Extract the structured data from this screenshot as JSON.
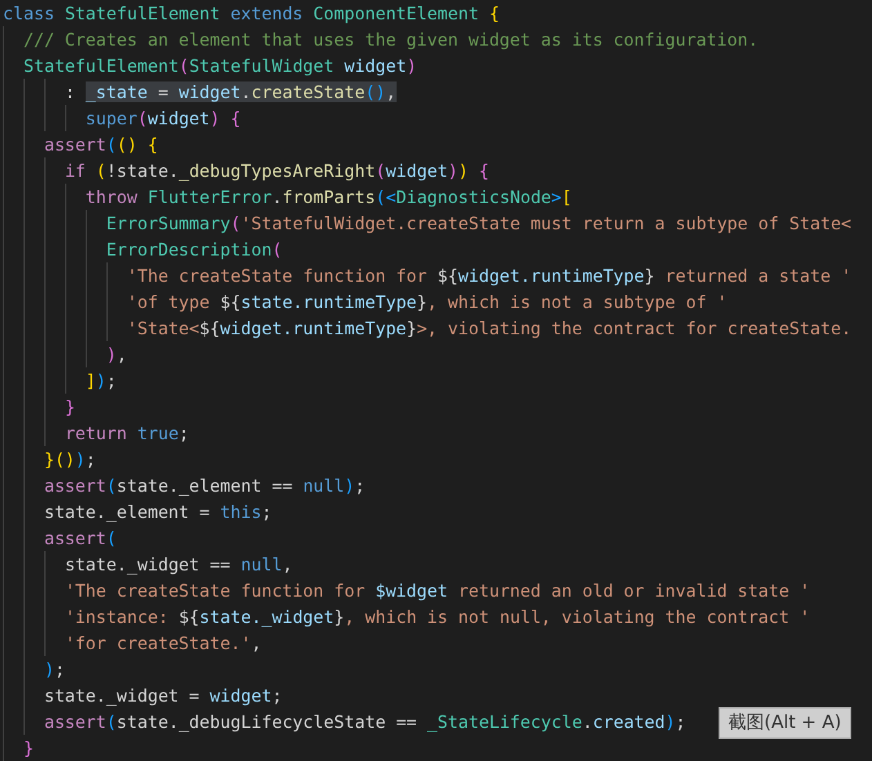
{
  "editor": {
    "lines": [
      {
        "tokens": [
          {
            "kind": "keyword",
            "text": "class "
          },
          {
            "kind": "type",
            "text": "StatefulElement "
          },
          {
            "kind": "keyword",
            "text": "extends "
          },
          {
            "kind": "type",
            "text": "ComponentElement "
          },
          {
            "kind": "b1",
            "text": "{"
          }
        ]
      },
      {
        "tokens": [
          {
            "kind": "comment",
            "text": "  /// Creates an element that uses the given widget as its configuration."
          }
        ]
      },
      {
        "tokens": [
          {
            "kind": "type",
            "text": "  StatefulElement"
          },
          {
            "kind": "b2",
            "text": "("
          },
          {
            "kind": "type",
            "text": "StatefulWidget "
          },
          {
            "kind": "param",
            "text": "widget"
          },
          {
            "kind": "b2",
            "text": ")"
          }
        ]
      },
      {
        "tokens": [
          {
            "kind": "plain",
            "text": "      : "
          },
          {
            "kind": "param",
            "text": "_state",
            "highlighted": true
          },
          {
            "kind": "plain",
            "text": " = ",
            "highlighted": true
          },
          {
            "kind": "param",
            "text": "widget",
            "highlighted": true
          },
          {
            "kind": "plain",
            "text": ".",
            "highlighted": true
          },
          {
            "kind": "func",
            "text": "createState",
            "highlighted": true
          },
          {
            "kind": "b3",
            "text": "()",
            "highlighted": true
          },
          {
            "kind": "plain",
            "text": ",",
            "highlighted": true
          }
        ]
      },
      {
        "tokens": [
          {
            "kind": "keyword",
            "text": "        super"
          },
          {
            "kind": "b2",
            "text": "("
          },
          {
            "kind": "param",
            "text": "widget"
          },
          {
            "kind": "b2",
            "text": ") {"
          }
        ]
      },
      {
        "tokens": [
          {
            "kind": "control",
            "text": "    assert"
          },
          {
            "kind": "b3",
            "text": "("
          },
          {
            "kind": "b1",
            "text": "() {"
          }
        ]
      },
      {
        "tokens": [
          {
            "kind": "control",
            "text": "      if "
          },
          {
            "kind": "b1",
            "text": "("
          },
          {
            "kind": "plain",
            "text": "!state."
          },
          {
            "kind": "func",
            "text": "_debugTypesAreRight"
          },
          {
            "kind": "b2",
            "text": "("
          },
          {
            "kind": "param",
            "text": "widget"
          },
          {
            "kind": "b2",
            "text": ")"
          },
          {
            "kind": "b1",
            "text": ")"
          },
          {
            "kind": "b2",
            "text": " {"
          }
        ]
      },
      {
        "tokens": [
          {
            "kind": "control",
            "text": "        throw "
          },
          {
            "kind": "type",
            "text": "FlutterError"
          },
          {
            "kind": "plain",
            "text": "."
          },
          {
            "kind": "func",
            "text": "fromParts"
          },
          {
            "kind": "b3",
            "text": "(<"
          },
          {
            "kind": "type",
            "text": "DiagnosticsNode"
          },
          {
            "kind": "b3",
            "text": ">"
          },
          {
            "kind": "b1",
            "text": "["
          }
        ]
      },
      {
        "tokens": [
          {
            "kind": "type",
            "text": "          ErrorSummary"
          },
          {
            "kind": "b2",
            "text": "("
          },
          {
            "kind": "string",
            "text": "'StatefulWidget.createState must return a subtype of State<"
          }
        ]
      },
      {
        "tokens": [
          {
            "kind": "type",
            "text": "          ErrorDescription"
          },
          {
            "kind": "b2",
            "text": "("
          }
        ]
      },
      {
        "tokens": [
          {
            "kind": "string",
            "text": "            'The createState function for "
          },
          {
            "kind": "plain",
            "text": "${"
          },
          {
            "kind": "param",
            "text": "widget.runtimeType"
          },
          {
            "kind": "plain",
            "text": "}"
          },
          {
            "kind": "string",
            "text": " returned a state '"
          }
        ]
      },
      {
        "tokens": [
          {
            "kind": "string",
            "text": "            'of type "
          },
          {
            "kind": "plain",
            "text": "${"
          },
          {
            "kind": "param",
            "text": "state.runtimeType"
          },
          {
            "kind": "plain",
            "text": "}"
          },
          {
            "kind": "string",
            "text": ", which is not a subtype of '"
          }
        ]
      },
      {
        "tokens": [
          {
            "kind": "string",
            "text": "            'State<"
          },
          {
            "kind": "plain",
            "text": "${"
          },
          {
            "kind": "param",
            "text": "widget.runtimeType"
          },
          {
            "kind": "plain",
            "text": "}"
          },
          {
            "kind": "string",
            "text": ">, violating the contract for createState."
          }
        ]
      },
      {
        "tokens": [
          {
            "kind": "b2",
            "text": "          )"
          },
          {
            "kind": "plain",
            "text": ","
          }
        ]
      },
      {
        "tokens": [
          {
            "kind": "b1",
            "text": "        ]"
          },
          {
            "kind": "b3",
            "text": ")"
          },
          {
            "kind": "plain",
            "text": ";"
          }
        ]
      },
      {
        "tokens": [
          {
            "kind": "b2",
            "text": "      }"
          }
        ]
      },
      {
        "tokens": [
          {
            "kind": "control",
            "text": "      return "
          },
          {
            "kind": "keyword",
            "text": "true"
          },
          {
            "kind": "plain",
            "text": ";"
          }
        ]
      },
      {
        "tokens": [
          {
            "kind": "b1",
            "text": "    }()"
          },
          {
            "kind": "b3",
            "text": ")"
          },
          {
            "kind": "plain",
            "text": ";"
          }
        ]
      },
      {
        "tokens": [
          {
            "kind": "control",
            "text": "    assert"
          },
          {
            "kind": "b3",
            "text": "("
          },
          {
            "kind": "plain",
            "text": "state._element == "
          },
          {
            "kind": "keyword",
            "text": "null"
          },
          {
            "kind": "b3",
            "text": ")"
          },
          {
            "kind": "plain",
            "text": ";"
          }
        ]
      },
      {
        "tokens": [
          {
            "kind": "plain",
            "text": "    state._element = "
          },
          {
            "kind": "keyword",
            "text": "this"
          },
          {
            "kind": "plain",
            "text": ";"
          }
        ]
      },
      {
        "tokens": [
          {
            "kind": "control",
            "text": "    assert"
          },
          {
            "kind": "b3",
            "text": "("
          }
        ]
      },
      {
        "tokens": [
          {
            "kind": "plain",
            "text": "      state._widget == "
          },
          {
            "kind": "keyword",
            "text": "null"
          },
          {
            "kind": "plain",
            "text": ","
          }
        ]
      },
      {
        "tokens": [
          {
            "kind": "string",
            "text": "      'The createState function for "
          },
          {
            "kind": "param",
            "text": "$widget"
          },
          {
            "kind": "string",
            "text": " returned an old or invalid state '"
          }
        ]
      },
      {
        "tokens": [
          {
            "kind": "string",
            "text": "      'instance: "
          },
          {
            "kind": "plain",
            "text": "${"
          },
          {
            "kind": "param",
            "text": "state._widget"
          },
          {
            "kind": "plain",
            "text": "}"
          },
          {
            "kind": "string",
            "text": ", which is not null, violating the contract '"
          }
        ]
      },
      {
        "tokens": [
          {
            "kind": "string",
            "text": "      'for createState.'"
          },
          {
            "kind": "plain",
            "text": ","
          }
        ]
      },
      {
        "tokens": [
          {
            "kind": "b3",
            "text": "    )"
          },
          {
            "kind": "plain",
            "text": ";"
          }
        ]
      },
      {
        "tokens": [
          {
            "kind": "plain",
            "text": "    state._widget = "
          },
          {
            "kind": "param",
            "text": "widget"
          },
          {
            "kind": "plain",
            "text": ";"
          }
        ]
      },
      {
        "tokens": [
          {
            "kind": "control",
            "text": "    assert"
          },
          {
            "kind": "b3",
            "text": "("
          },
          {
            "kind": "plain",
            "text": "state._debugLifecycleState == "
          },
          {
            "kind": "type",
            "text": "_StateLifecycle"
          },
          {
            "kind": "plain",
            "text": "."
          },
          {
            "kind": "param",
            "text": "created"
          },
          {
            "kind": "b3",
            "text": ")"
          },
          {
            "kind": "plain",
            "text": ";"
          }
        ]
      },
      {
        "tokens": [
          {
            "kind": "b2",
            "text": "  }"
          }
        ]
      }
    ]
  },
  "tooltip": {
    "text": "截图(Alt + A)"
  }
}
